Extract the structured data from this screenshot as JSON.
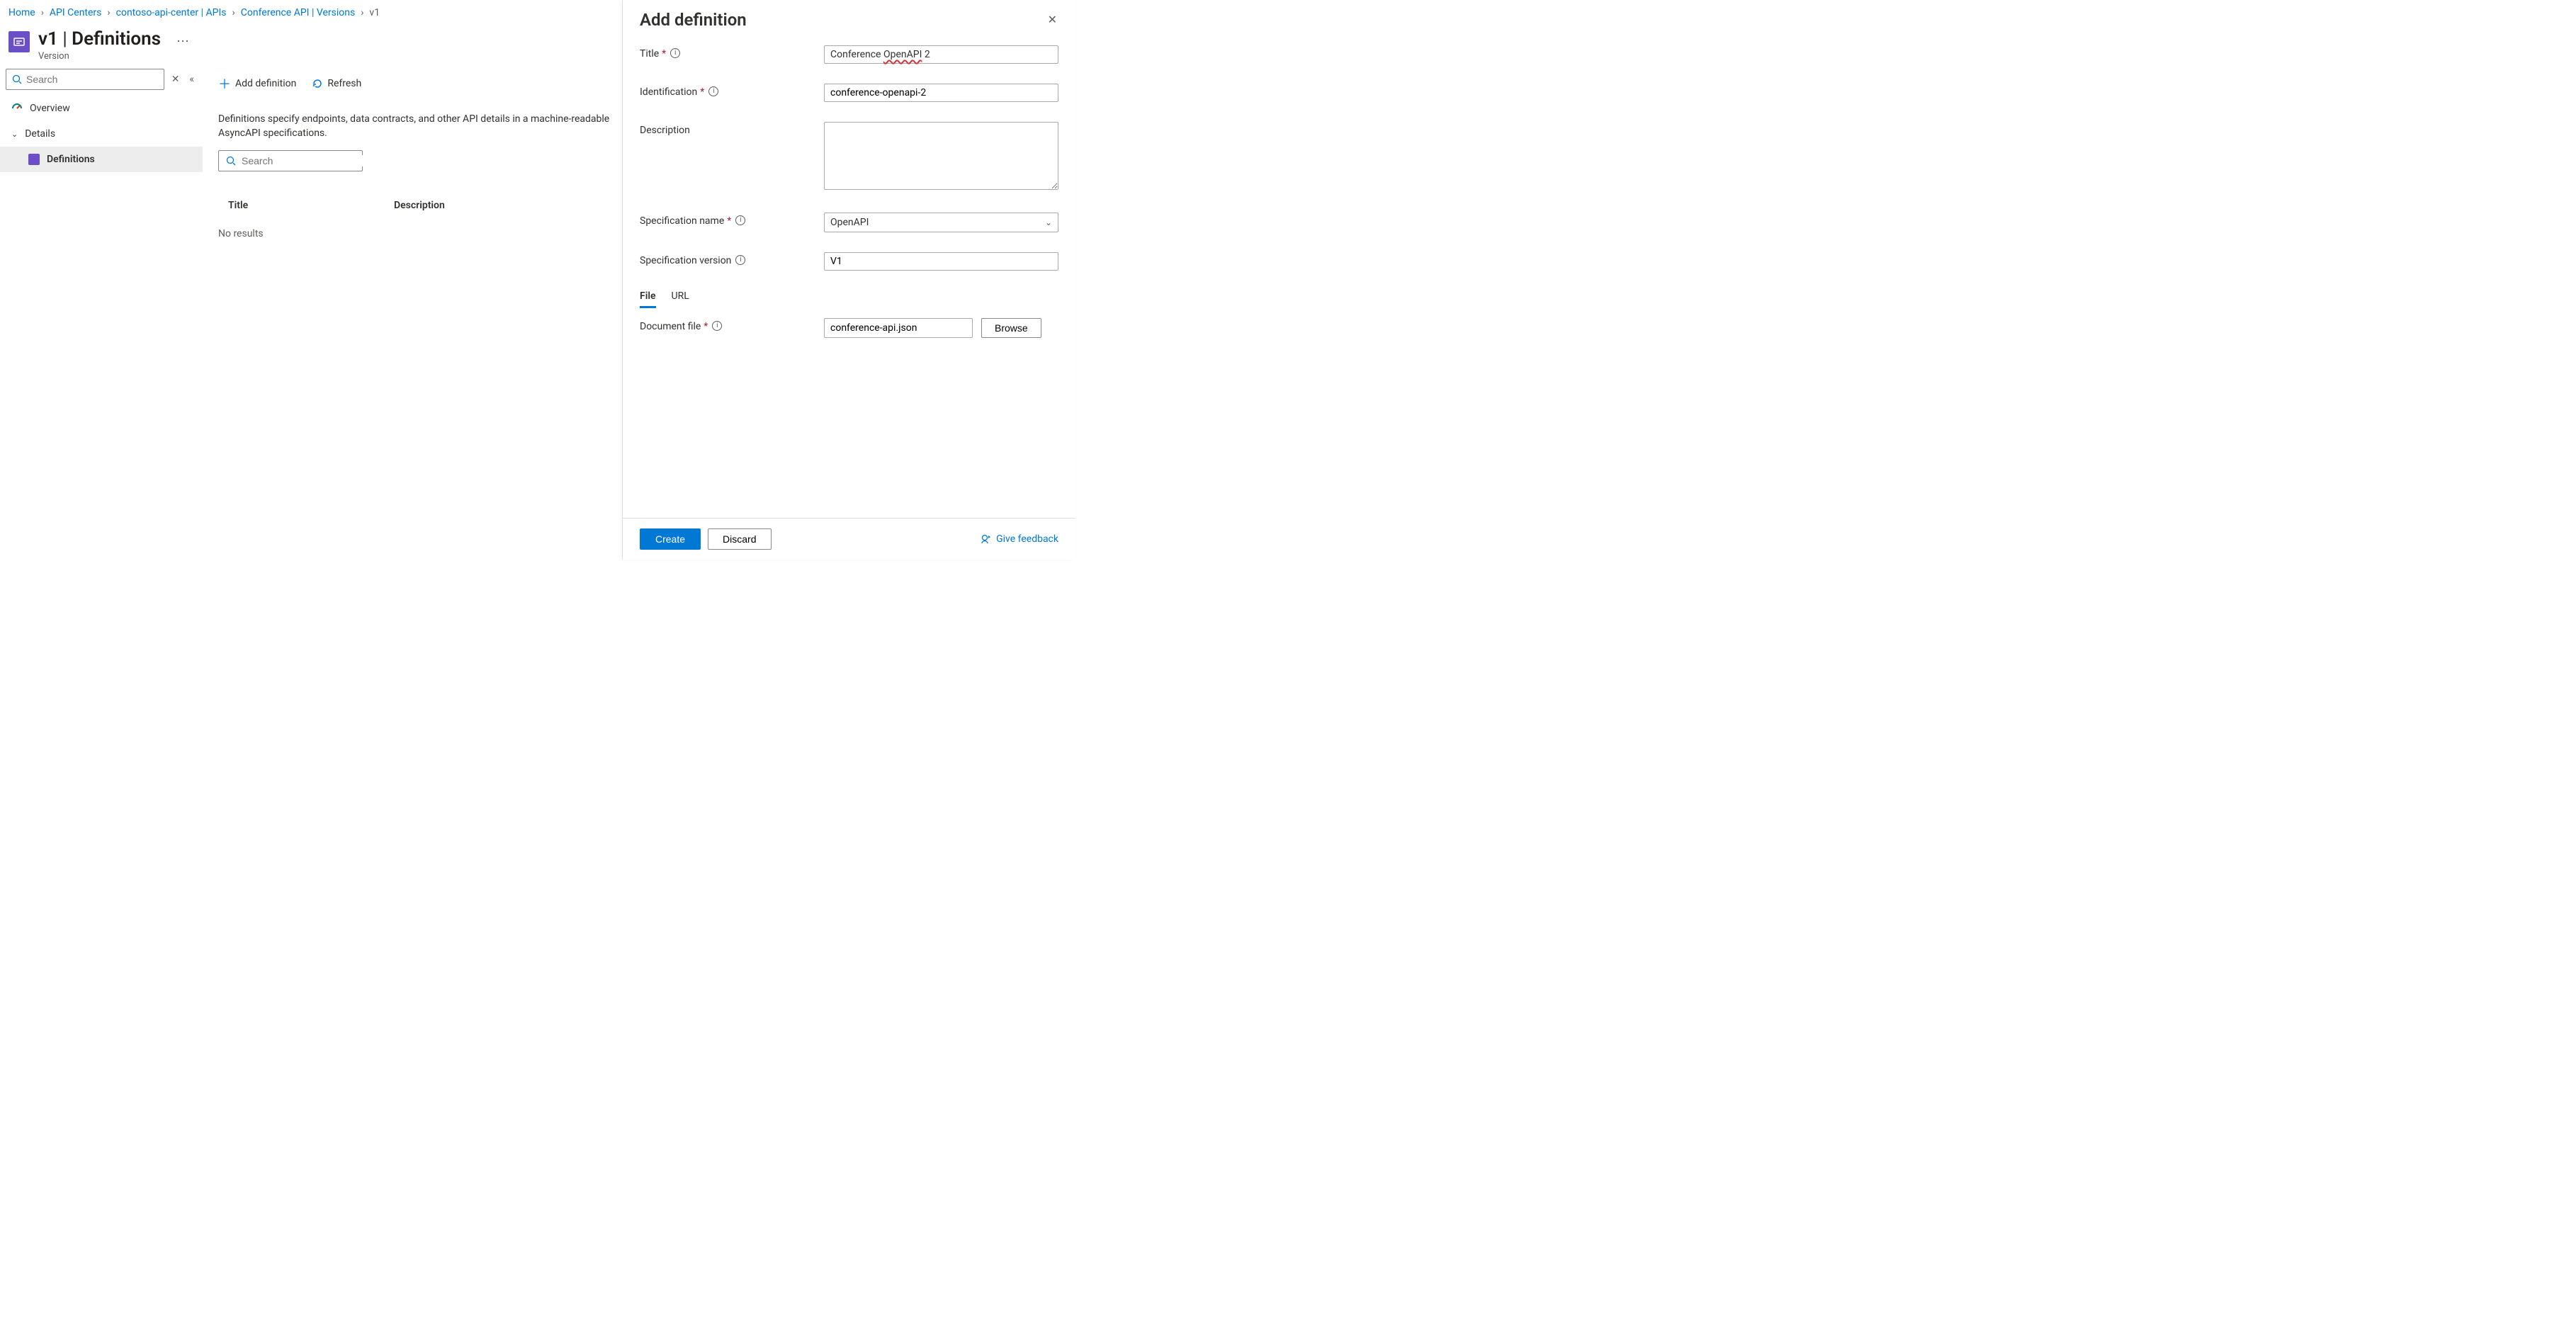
{
  "breadcrumb": [
    {
      "label": "Home",
      "link": true
    },
    {
      "label": "API Centers",
      "link": true
    },
    {
      "label": "contoso-api-center | APIs",
      "link": true
    },
    {
      "label": "Conference API | Versions",
      "link": true
    },
    {
      "label": "v1",
      "link": false
    }
  ],
  "header": {
    "title_left": "v1",
    "title_right": "Definitions",
    "subtitle": "Version"
  },
  "sidebar": {
    "search_placeholder": "Search",
    "items": [
      {
        "label": "Overview",
        "icon": "overview"
      },
      {
        "label": "Details",
        "icon": "details",
        "expandable": true
      },
      {
        "label": "Definitions",
        "icon": "definitions",
        "selected": true,
        "level": 2
      }
    ]
  },
  "commands": {
    "add": "Add definition",
    "refresh": "Refresh"
  },
  "main": {
    "description": "Definitions specify endpoints, data contracts, and other API details in a machine-readable AsyncAPI specifications.",
    "search_placeholder": "Search",
    "columns": [
      "Title",
      "Description"
    ],
    "empty": "No results"
  },
  "panel": {
    "title": "Add definition",
    "fields": {
      "title": {
        "label": "Title",
        "required": true,
        "info": true,
        "value_plain": "Conference ",
        "value_wave": "OpenAPI",
        "value_tail": " 2"
      },
      "identification": {
        "label": "Identification",
        "required": true,
        "info": true,
        "value": "conference-openapi-2"
      },
      "description": {
        "label": "Description",
        "required": false,
        "value": ""
      },
      "spec_name": {
        "label": "Specification name",
        "required": true,
        "info": true,
        "value": "OpenAPI"
      },
      "spec_version": {
        "label": "Specification version",
        "info": true,
        "value": "V1"
      },
      "tabs": [
        "File",
        "URL"
      ],
      "active_tab": "File",
      "doc_file": {
        "label": "Document file",
        "required": true,
        "info": true,
        "value": "conference-api.json"
      },
      "browse": "Browse"
    },
    "footer": {
      "primary": "Create",
      "secondary": "Discard",
      "feedback": "Give feedback"
    }
  }
}
